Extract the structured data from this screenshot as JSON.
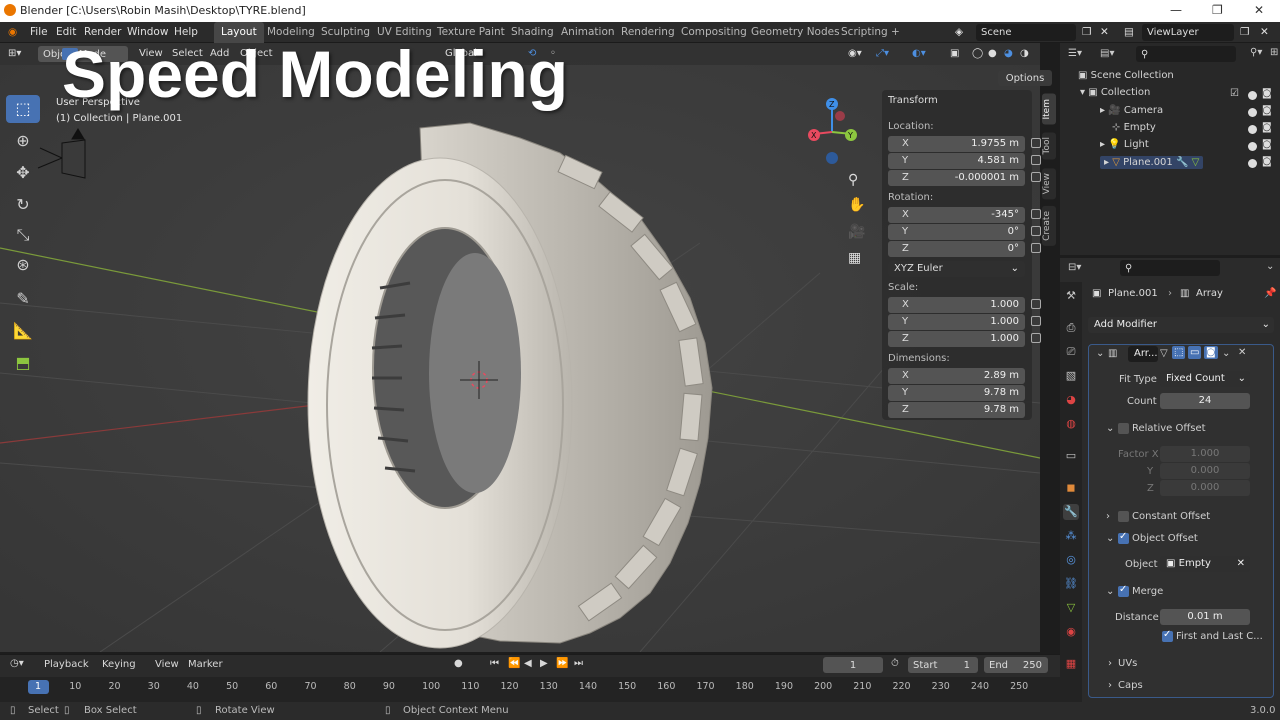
{
  "window": {
    "title": "Blender [C:\\Users\\Robin Masih\\Desktop\\TYRE.blend]",
    "min": "—",
    "max": "❐",
    "close": "✕"
  },
  "menus": [
    "File",
    "Edit",
    "Render",
    "Window",
    "Help"
  ],
  "workspaces": [
    "Layout",
    "Modeling",
    "Sculpting",
    "UV Editing",
    "Texture Paint",
    "Shading",
    "Animation",
    "Rendering",
    "Compositing",
    "Geometry Nodes",
    "Scripting",
    "+"
  ],
  "active_workspace": "Layout",
  "scene": "Scene",
  "view_layer": "ViewLayer",
  "overlay_text": "Speed Modeling",
  "viewport": {
    "mode": "Object Mode",
    "menus": [
      "View",
      "Select",
      "Add",
      "Object"
    ],
    "orientation": "Global",
    "options": "Options",
    "perspective": "User Perspective",
    "collection_info": "(1) Collection | Plane.001"
  },
  "gizmo": {
    "z": "Z",
    "y": "Y",
    "x": "X"
  },
  "transform": {
    "title": "Transform",
    "location_label": "Location:",
    "location": [
      {
        "ax": "X",
        "val": "1.9755 m"
      },
      {
        "ax": "Y",
        "val": "4.581 m"
      },
      {
        "ax": "Z",
        "val": "-0.000001 m"
      }
    ],
    "rotation_label": "Rotation:",
    "rotation": [
      {
        "ax": "X",
        "val": "-345°"
      },
      {
        "ax": "Y",
        "val": "0°"
      },
      {
        "ax": "Z",
        "val": "0°"
      }
    ],
    "rotation_mode": "XYZ Euler",
    "scale_label": "Scale:",
    "scale": [
      {
        "ax": "X",
        "val": "1.000"
      },
      {
        "ax": "Y",
        "val": "1.000"
      },
      {
        "ax": "Z",
        "val": "1.000"
      }
    ],
    "dimensions_label": "Dimensions:",
    "dimensions": [
      {
        "ax": "X",
        "val": "2.89 m"
      },
      {
        "ax": "Y",
        "val": "9.78 m"
      },
      {
        "ax": "Z",
        "val": "9.78 m"
      }
    ]
  },
  "side_tabs": [
    "Item",
    "Tool",
    "View",
    "Create"
  ],
  "outliner": {
    "items": [
      {
        "name": "Scene Collection"
      },
      {
        "name": "Collection"
      },
      {
        "name": "Camera"
      },
      {
        "name": "Empty"
      },
      {
        "name": "Light"
      },
      {
        "name": "Plane.001"
      }
    ]
  },
  "properties": {
    "object": "Plane.001",
    "modifier_path": "Array",
    "add_modifier": "Add Modifier",
    "modifier_name": "Arr...",
    "fit_type_label": "Fit Type",
    "fit_type": "Fixed Count",
    "count_label": "Count",
    "count": "24",
    "relative_offset": "Relative Offset",
    "factor_x_label": "Factor X",
    "factor_x": "1.000",
    "factor_y_label": "Y",
    "factor_y": "0.000",
    "factor_z_label": "Z",
    "factor_z": "0.000",
    "constant_offset": "Constant Offset",
    "object_offset": "Object Offset",
    "object_label": "Object",
    "object_value": "Empty",
    "merge": "Merge",
    "distance_label": "Distance",
    "distance": "0.01 m",
    "first_last": "First and Last C...",
    "uvs": "UVs",
    "caps": "Caps"
  },
  "timeline": {
    "menus": [
      "Playback",
      "Keying",
      "View",
      "Marker"
    ],
    "current_frame": "1",
    "start_label": "Start",
    "start": "1",
    "end_label": "End",
    "end": "250",
    "ticks": [
      "1",
      "10",
      "20",
      "30",
      "40",
      "50",
      "60",
      "70",
      "80",
      "90",
      "100",
      "110",
      "120",
      "130",
      "140",
      "150",
      "160",
      "170",
      "180",
      "190",
      "200",
      "210",
      "220",
      "230",
      "240",
      "250"
    ]
  },
  "status": {
    "select": "Select",
    "box_select": "Box Select",
    "rotate": "Rotate View",
    "context": "Object Context Menu",
    "version": "3.0.0"
  },
  "colors": {
    "accent": "#4772b3",
    "tyre": "#e6e3dc",
    "x_axis": "#e84a5f",
    "y_axis": "#8cc63f",
    "z_axis": "#3f8fe8"
  }
}
